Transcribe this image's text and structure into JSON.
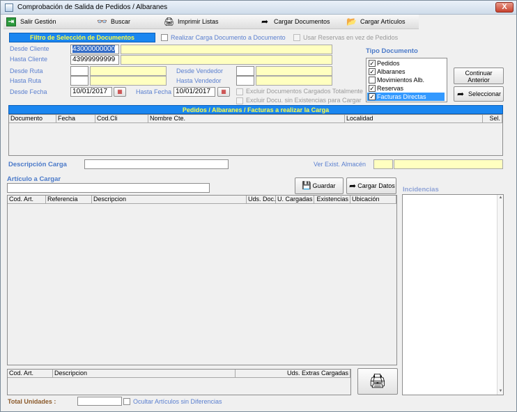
{
  "window": {
    "title": "Comprobación de Salida de Pedidos / Albaranes",
    "close_label": "X"
  },
  "toolbar": {
    "salir": "Salir Gestión",
    "buscar": "Buscar",
    "imprimir": "Imprimir Listas",
    "cargar_docs": "Cargar Documentos",
    "cargar_arts": "Cargar Artículos"
  },
  "filtro": {
    "header": "Filtro de Selección de Documentos",
    "realizar_carga": "Realizar Carga Documento a Documento",
    "usar_reservas": "Usar Reservas en vez de Pedidos",
    "desde_cliente_label": "Desde Cliente",
    "desde_cliente_value": "43000000000",
    "hasta_cliente_label": "Hasta Cliente",
    "hasta_cliente_value": "43999999999",
    "desde_ruta_label": "Desde Ruta",
    "hasta_ruta_label": "Hasta Ruta",
    "desde_vendedor_label": "Desde Vendedor",
    "hasta_vendedor_label": "Hasta Vendedor",
    "desde_fecha_label": "Desde Fecha",
    "desde_fecha_value": "10/01/2017",
    "hasta_fecha_label": "Hasta Fecha",
    "hasta_fecha_value": "10/01/2017",
    "excluir_cargados": "Excluir Documentos Cargados Totalmente",
    "excluir_sin_exist": "Excluir Docu. sin Existencias para Cargar"
  },
  "tipo_documento": {
    "title": "Tipo Documento",
    "items": [
      {
        "label": "Pedidos",
        "checked": true
      },
      {
        "label": "Albaranes",
        "checked": true
      },
      {
        "label": "Movimientos Alb.",
        "checked": false
      },
      {
        "label": "Reservas",
        "checked": true
      },
      {
        "label": "Facturas Directas",
        "checked": true
      }
    ]
  },
  "buttons": {
    "continuar_l1": "Continuar",
    "continuar_l2": "Anterior",
    "seleccionar": "Seleccionar",
    "guardar": "Guardar",
    "cargar_datos": "Cargar Datos"
  },
  "pedidos_grid": {
    "header": "Pedidos / Albaranes / Facturas a realizar la Carga",
    "columns": [
      "Documento",
      "Fecha",
      "Cod.Cli",
      "Nombre Cte.",
      "Localidad",
      "Sel."
    ]
  },
  "descripcion_carga_label": "Descripción Carga",
  "ver_exist_label": "Ver Exist. Almacén",
  "articulo": {
    "title": "Artículo a Cargar",
    "columns": [
      "Cod. Art.",
      "Referencia",
      "Descripcion",
      "Uds. Doc.",
      "U. Cargadas",
      "Existencias",
      "Ubicación"
    ]
  },
  "extras_grid": {
    "columns": [
      "Cod. Art.",
      "Descripcion",
      "Uds. Extras Cargadas"
    ]
  },
  "incidencias_title": "Incidencias",
  "footer": {
    "total_unidades": "Total Unidades :",
    "ocultar": "Ocultar Artículos sin Diferencias"
  }
}
